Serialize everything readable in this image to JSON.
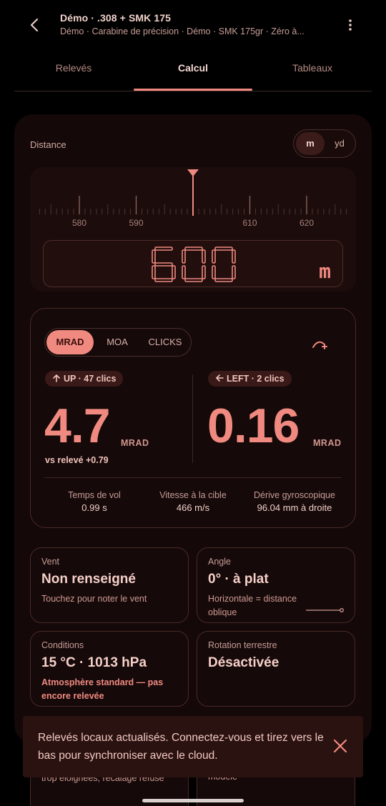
{
  "header": {
    "title": "Démo · .308 + SMK 175",
    "subtitle": "Démo · Carabine de précision · Démo · SMK 175gr · Zéro à..."
  },
  "tabs": [
    {
      "label": "Relevés"
    },
    {
      "label": "Calcul"
    },
    {
      "label": "Tableaux"
    }
  ],
  "distance": {
    "label": "Distance",
    "units": {
      "metric": "m",
      "imperial": "yd",
      "selected": "m"
    },
    "ruler_ticks": [
      {
        "label": "580",
        "value": 580
      },
      {
        "label": "590",
        "value": 590
      },
      {
        "label": "610",
        "value": 610
      },
      {
        "label": "620",
        "value": 620
      }
    ],
    "value": "600",
    "value_numeric": 600,
    "unit_display": "m"
  },
  "result": {
    "modes": [
      "MRAD",
      "MOA",
      "CLICKS"
    ],
    "selected_mode": "MRAD",
    "elevation": {
      "chip": "UP · 47 clics",
      "value": "4.7",
      "unit": "MRAD",
      "delta": "vs relevé +0.79"
    },
    "windage": {
      "chip": "LEFT · 2 clics",
      "value": "0.16",
      "unit": "MRAD"
    },
    "stats": [
      {
        "label": "Temps de vol",
        "value": "0.99 s"
      },
      {
        "label": "Vitesse à la cible",
        "value": "466 m/s"
      },
      {
        "label": "Dérive gyroscopique",
        "value": "96.04 mm à droite"
      }
    ]
  },
  "tiles": {
    "wind": {
      "label": "Vent",
      "value": "Non renseigné",
      "sub": "Touchez pour noter le vent"
    },
    "angle": {
      "label": "Angle",
      "value": "0° · à plat",
      "sub": "Horizontale = distance oblique"
    },
    "conditions": {
      "label": "Conditions",
      "value": "15 °C · 1013 hPa",
      "sub": "Atmosphère standard — pas encore relevée"
    },
    "rotation": {
      "label": "Rotation terrestre",
      "value": "Désactivée"
    },
    "partial_left_sub": "trop éloignées, recalage refusé",
    "partial_right_sub": "modèle"
  },
  "toast": {
    "message": "Relevés locaux actualisés. Connectez-vous et tirez vers le bas pour synchroniser avec le cloud."
  },
  "colors": {
    "accent": "#f08a80",
    "background": "#000000",
    "card": "#140808"
  },
  "icons": {
    "back": "arrow-left-icon",
    "more": "more-vertical-icon",
    "trajectory": "trajectory-icon",
    "up": "arrow-up-icon",
    "left": "arrow-left-icon",
    "close": "close-icon"
  }
}
